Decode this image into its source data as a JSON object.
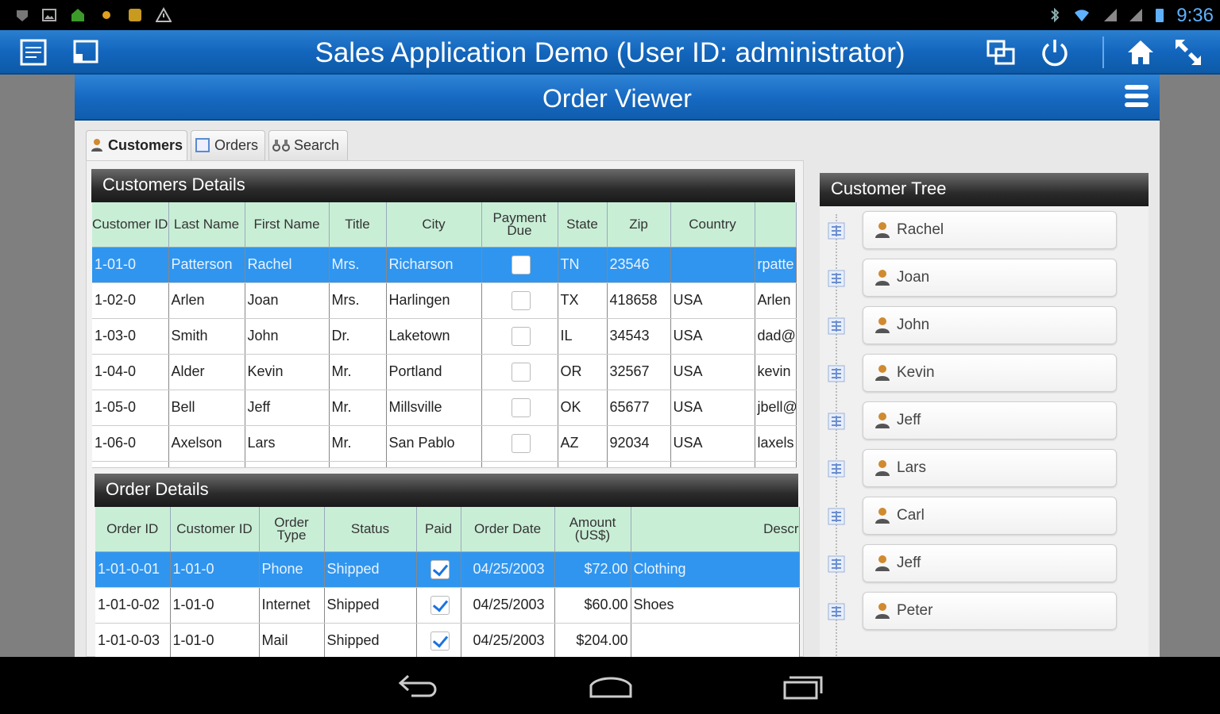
{
  "status_bar": {
    "time": "9:36"
  },
  "app": {
    "title": "Sales Application Demo (User ID: administrator)"
  },
  "viewer": {
    "title": "Order Viewer"
  },
  "tabs": [
    {
      "label": "Customers",
      "icon": "person-icon",
      "active": true
    },
    {
      "label": "Orders",
      "icon": "document-icon",
      "active": false
    },
    {
      "label": "Search",
      "icon": "binoculars-icon",
      "active": false
    }
  ],
  "customers": {
    "title": "Customers Details",
    "columns": [
      "Customer ID",
      "Last Name",
      "First Name",
      "Title",
      "City",
      "Payment Due",
      "State",
      "Zip",
      "Country",
      ""
    ],
    "rows": [
      {
        "id": "1-01-0",
        "last": "Patterson",
        "first": "Rachel",
        "title": "Mrs.",
        "city": "Richarson",
        "due": false,
        "state": "TN",
        "zip": "23546",
        "country": "",
        "email": "rpatte"
      },
      {
        "id": "1-02-0",
        "last": "Arlen",
        "first": "Joan",
        "title": "Mrs.",
        "city": "Harlingen",
        "due": false,
        "state": "TX",
        "zip": "418658",
        "country": "USA",
        "email": "Arlen"
      },
      {
        "id": "1-03-0",
        "last": "Smith",
        "first": "John",
        "title": "Dr.",
        "city": "Laketown",
        "due": false,
        "state": "IL",
        "zip": "34543",
        "country": "USA",
        "email": "dad@"
      },
      {
        "id": "1-04-0",
        "last": "Alder",
        "first": "Kevin",
        "title": "Mr.",
        "city": "Portland",
        "due": false,
        "state": "OR",
        "zip": "32567",
        "country": "USA",
        "email": "kevin"
      },
      {
        "id": "1-05-0",
        "last": "Bell",
        "first": "Jeff",
        "title": "Mr.",
        "city": "Millsville",
        "due": false,
        "state": "OK",
        "zip": "65677",
        "country": "USA",
        "email": "jbell@"
      },
      {
        "id": "1-06-0",
        "last": "Axelson",
        "first": "Lars",
        "title": "Mr.",
        "city": "San Pablo",
        "due": false,
        "state": "AZ",
        "zip": "92034",
        "country": "USA",
        "email": "laxels"
      }
    ]
  },
  "orders": {
    "title": "Order Details",
    "columns": [
      "Order ID",
      "Customer ID",
      "Order Type",
      "Status",
      "Paid",
      "Order Date",
      "Amount (US$)",
      "Descr"
    ],
    "rows": [
      {
        "order_id": "1-01-0-01",
        "cust_id": "1-01-0",
        "type": "Phone",
        "status": "Shipped",
        "paid": true,
        "date": "04/25/2003",
        "amount": "$72.00",
        "desc": "Clothing"
      },
      {
        "order_id": "1-01-0-02",
        "cust_id": "1-01-0",
        "type": "Internet",
        "status": "Shipped",
        "paid": true,
        "date": "04/25/2003",
        "amount": "$60.00",
        "desc": "Shoes"
      },
      {
        "order_id": "1-01-0-03",
        "cust_id": "1-01-0",
        "type": "Mail",
        "status": "Shipped",
        "paid": true,
        "date": "04/25/2003",
        "amount": "$204.00",
        "desc": ""
      }
    ]
  },
  "tree": {
    "title": "Customer Tree",
    "nodes": [
      "Rachel",
      "Joan",
      "John",
      "Kevin",
      "Jeff",
      "Lars",
      "Carl",
      "Jeff",
      "Peter"
    ]
  },
  "colors": {
    "accent": "#1668c0",
    "selected_row": "#2f95ef",
    "header_mint": "#c9eed6"
  }
}
